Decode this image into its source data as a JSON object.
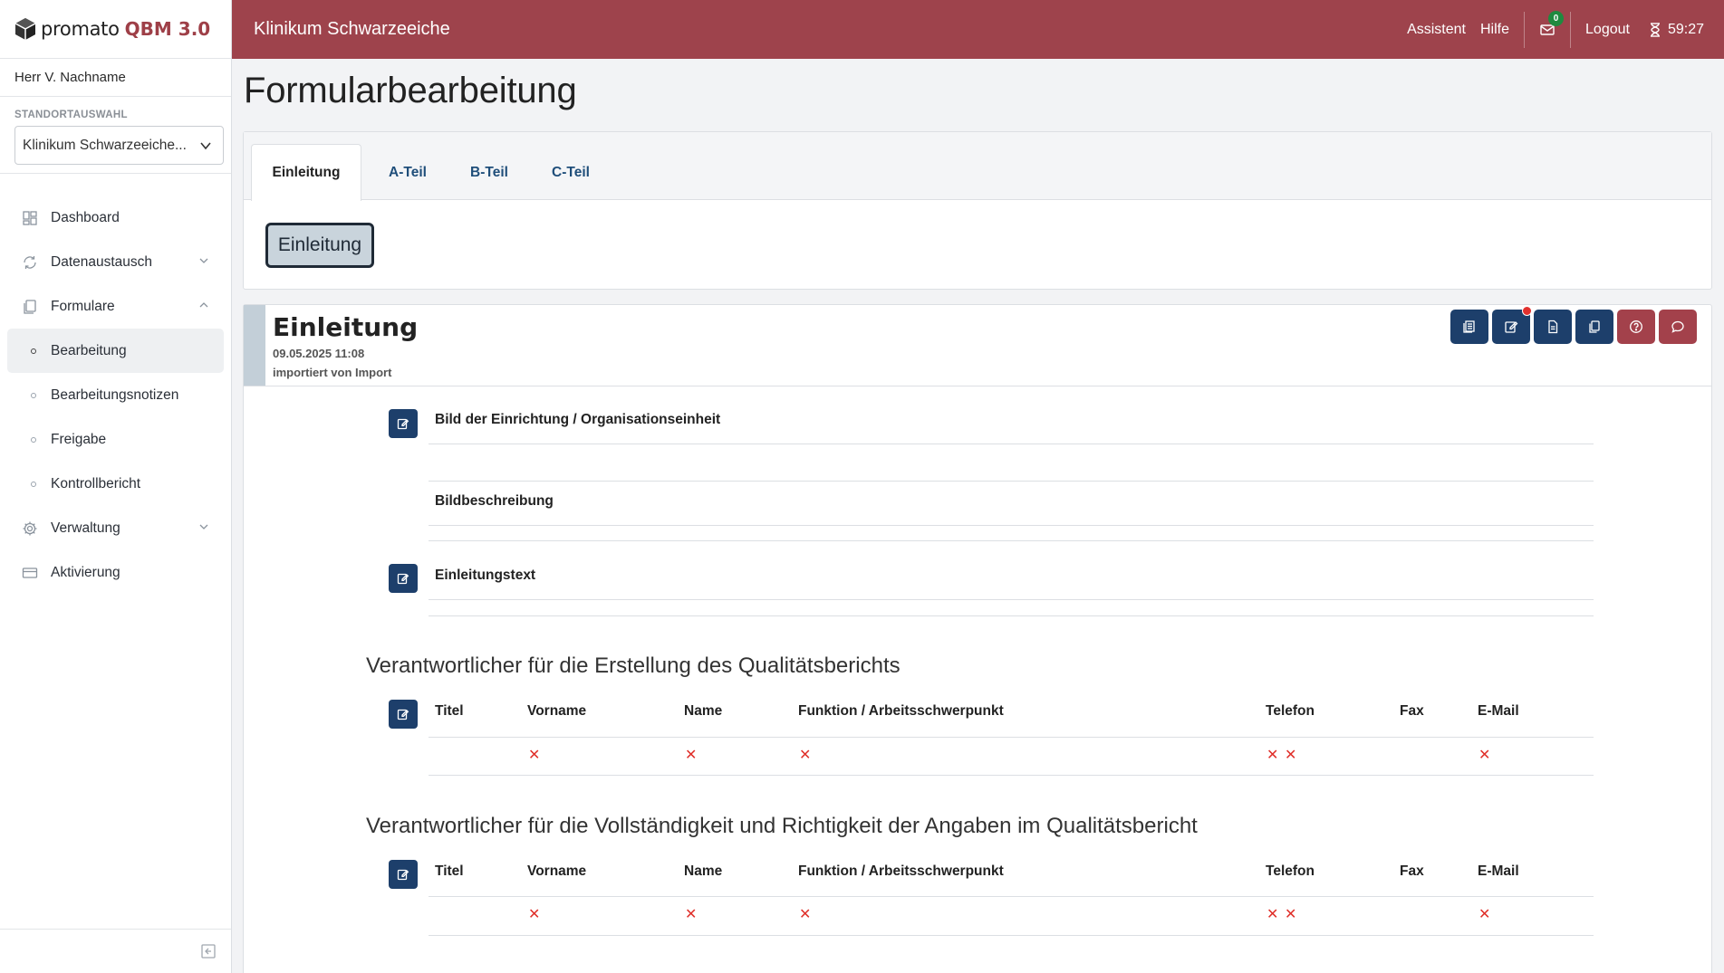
{
  "brand": {
    "name": "promato",
    "product": "QBM 3.0"
  },
  "user": {
    "name": "Herr V. Nachname"
  },
  "site": {
    "label": "STANDORTAUSWAHL",
    "selected": "Klinikum Schwarzeeiche..."
  },
  "nav": {
    "dashboard": "Dashboard",
    "datenaustausch": "Datenaustausch",
    "formulare": "Formulare",
    "bearbeitung": "Bearbeitung",
    "notizen": "Bearbeitungsnotizen",
    "freigabe": "Freigabe",
    "kontrollbericht": "Kontrollbericht",
    "verwaltung": "Verwaltung",
    "aktivierung": "Aktivierung"
  },
  "topbar": {
    "title": "Klinikum Schwarzeeiche",
    "assistent": "Assistent",
    "hilfe": "Hilfe",
    "mail_count": "0",
    "logout": "Logout",
    "timer": "59:27"
  },
  "page": {
    "title": "Formularbearbeitung"
  },
  "tabs": [
    "Einleitung",
    "A-Teil",
    "B-Teil",
    "C-Teil"
  ],
  "subsection_button": "Einleitung",
  "section": {
    "title": "Einleitung",
    "date": "09.05.2025 11:08",
    "source": "importiert von Import"
  },
  "fields": {
    "bild": "Bild der Einrichtung / Organisationseinheit",
    "bildbeschreibung": "Bildbeschreibung",
    "einleitungstext": "Einleitungstext"
  },
  "table_headers": [
    "Titel",
    "Vorname",
    "Name",
    "Funktion / Arbeitsschwerpunkt",
    "Telefon",
    "Fax",
    "E-Mail"
  ],
  "responsible_1": {
    "heading": "Verantwortlicher für die Erstellung des Qualitätsberichts"
  },
  "responsible_2": {
    "heading": "Verantwortlicher für die Vollständigkeit und Richtigkeit der Angaben im Qualitätsbericht"
  },
  "missing_mark": "✕"
}
